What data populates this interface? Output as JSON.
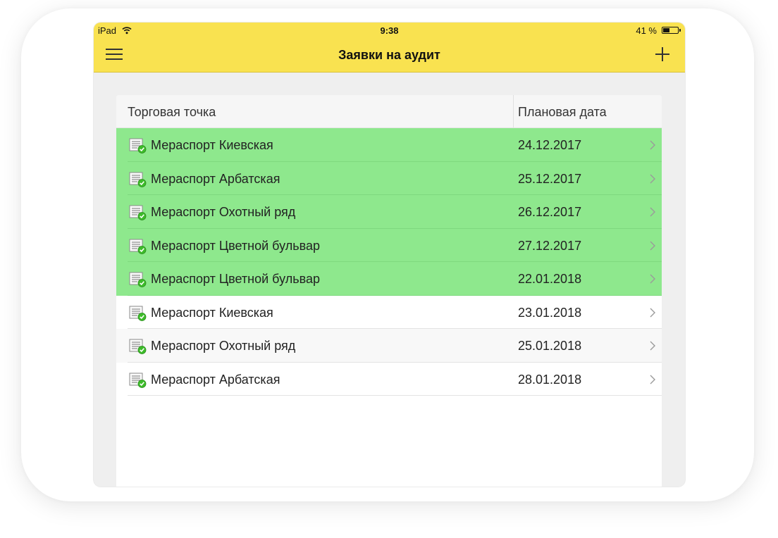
{
  "status_bar": {
    "device": "iPad",
    "time": "9:38",
    "battery": "41 %"
  },
  "nav": {
    "title": "Заявки на аудит",
    "menu_icon": "hamburger-icon",
    "add_icon": "plus-icon"
  },
  "table": {
    "columns": [
      "Торговая точка",
      "Плановая дата"
    ],
    "highlight_color": "#8ee88d",
    "rows": [
      {
        "name": "Мераспорт Киевская",
        "date": "24.12.2017",
        "highlighted": true
      },
      {
        "name": "Мераспорт Арбатская",
        "date": "25.12.2017",
        "highlighted": true
      },
      {
        "name": "Мераспорт Охотный ряд",
        "date": "26.12.2017",
        "highlighted": true
      },
      {
        "name": "Мераспорт Цветной бульвар",
        "date": "27.12.2017",
        "highlighted": true
      },
      {
        "name": "Мераспорт Цветной бульвар",
        "date": "22.01.2018",
        "highlighted": true
      },
      {
        "name": "Мераспорт Киевская",
        "date": "23.01.2018",
        "highlighted": false
      },
      {
        "name": "Мераспорт Охотный ряд",
        "date": "25.01.2018",
        "highlighted": false
      },
      {
        "name": "Мераспорт Арбатская",
        "date": "28.01.2018",
        "highlighted": false
      }
    ]
  },
  "colors": {
    "navbar": "#f9e250",
    "background": "#efefef"
  }
}
